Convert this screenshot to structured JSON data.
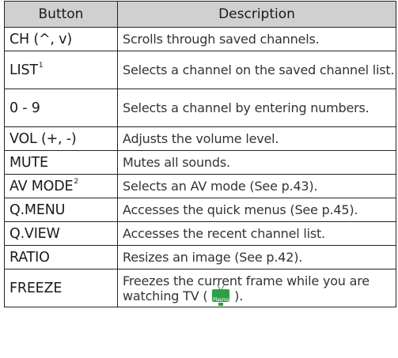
{
  "table": {
    "headers": {
      "button": "Button",
      "description": "Description"
    },
    "rows": [
      {
        "button": "CH (^, v)",
        "sup": "",
        "description": "Scrolls through saved channels."
      },
      {
        "button": "LIST",
        "sup": "1",
        "description": "Selects a channel on the saved channel list."
      },
      {
        "button": "0 - 9",
        "sup": "",
        "description": "Selects a channel by entering numbers."
      },
      {
        "button": "VOL (+, -)",
        "sup": "",
        "description": "Adjusts the volume level."
      },
      {
        "button": "MUTE",
        "sup": "",
        "description": "Mutes all sounds."
      },
      {
        "button": "AV MODE",
        "sup": "2",
        "description": "Selects an AV mode (See p.43)."
      },
      {
        "button": "Q.MENU",
        "sup": "",
        "description": "Accesses the quick menus (See p.45)."
      },
      {
        "button": "Q.VIEW",
        "sup": "",
        "description": "Accesses the recent channel list."
      },
      {
        "button": "RATIO",
        "sup": "",
        "description": "Resizes an image (See p.42)."
      },
      {
        "button": "FREEZE",
        "sup": "",
        "description": "Freezes the current frame while you are watching TV (",
        "description_end": ").",
        "icon_label": "Plasma",
        "icon": "plasma-tv-icon"
      }
    ]
  },
  "colors": {
    "header_bg": "#d0d0d0",
    "border": "#222222",
    "plasma_icon": "#2ea043"
  }
}
